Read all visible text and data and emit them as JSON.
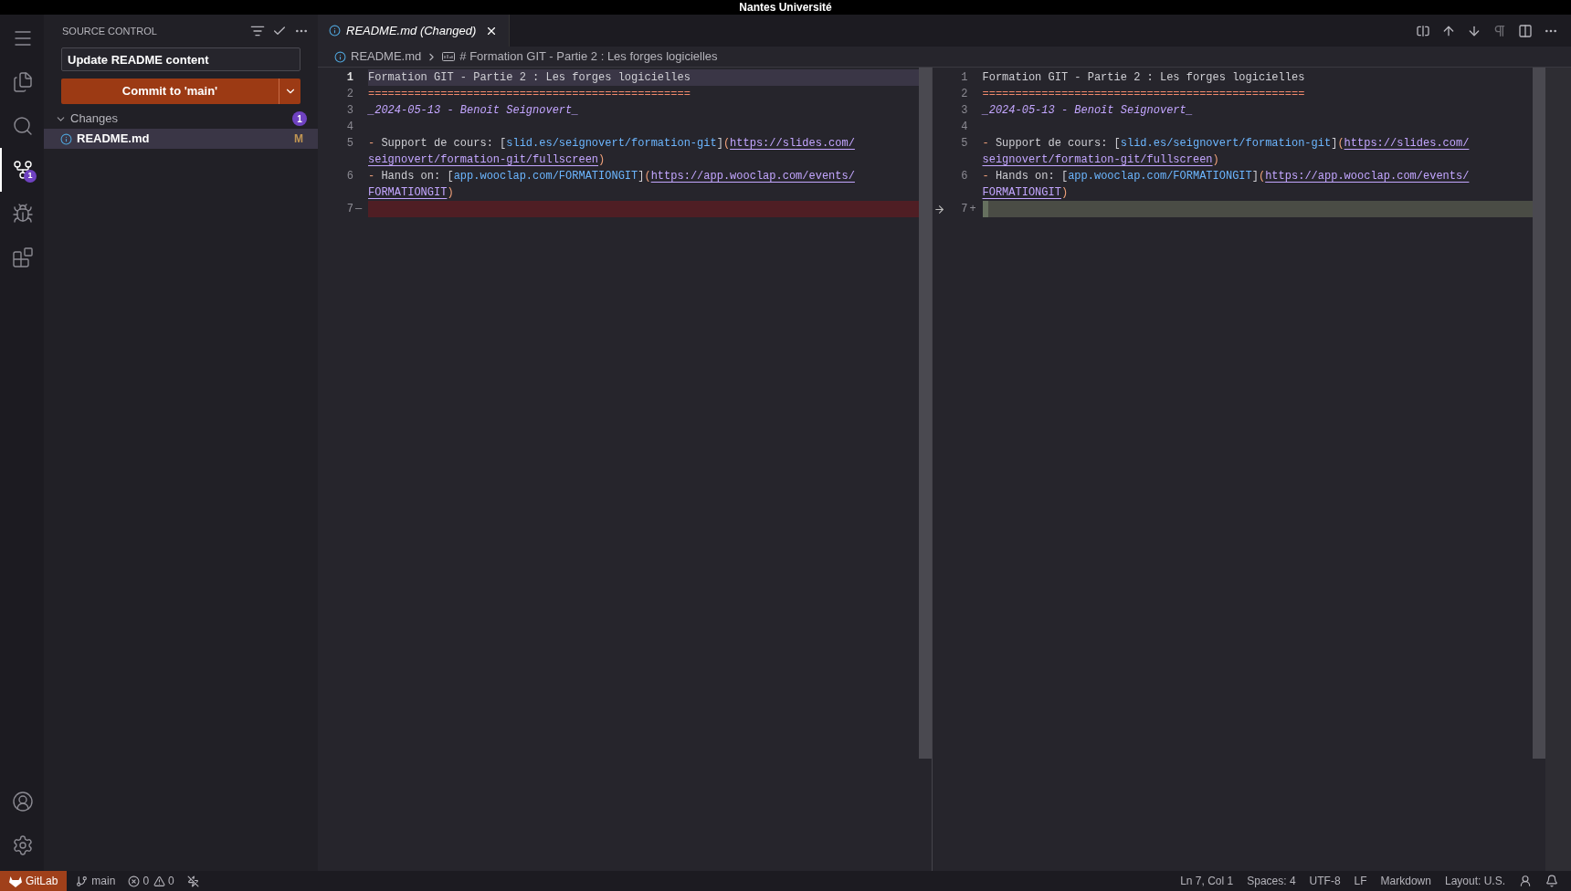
{
  "title_bar": {
    "title": "Nantes Université"
  },
  "activity_bar": {
    "items": [
      {
        "kind": "menu",
        "selected": false
      },
      {
        "kind": "explorer",
        "selected": false
      },
      {
        "kind": "search",
        "selected": false
      },
      {
        "kind": "source_control",
        "selected": true,
        "badge": "1"
      },
      {
        "kind": "debug",
        "selected": false
      },
      {
        "kind": "extensions",
        "selected": false
      }
    ],
    "bottom": [
      {
        "kind": "account",
        "selected": false
      },
      {
        "kind": "settings",
        "selected": false
      }
    ]
  },
  "sidebar": {
    "title": "SOURCE CONTROL",
    "message": {
      "value": "Update README content"
    },
    "commit_button": "Commit to 'main'",
    "changes": {
      "label": "Changes",
      "expanded": true,
      "count": "1",
      "files": [
        {
          "name": "README.md",
          "status": "M",
          "selected": true
        }
      ]
    }
  },
  "editor": {
    "tabs": [
      {
        "label": "README.md (Changed)",
        "selected": true
      }
    ],
    "breadcrumb": [
      "README.md",
      "# Formation GIT - Partie 2 : Les forges logicielles"
    ],
    "panes": [
      {
        "lines": [
          {
            "number": "1",
            "highlighted": true,
            "kind": "unchanged",
            "segments": [
              {
                "kind": "plain",
                "text": "Formation GIT - Partie 2 : Les forges logicielles"
              }
            ]
          },
          {
            "number": "2",
            "highlighted": false,
            "kind": "unchanged",
            "segments": [
              {
                "kind": "rule",
                "text": "================================================="
              }
            ]
          },
          {
            "number": "3",
            "highlighted": false,
            "kind": "unchanged",
            "segments": [
              {
                "kind": "emph",
                "text": "_2024-05-13 - Benoît Seignovert_"
              }
            ]
          },
          {
            "number": "4",
            "highlighted": false,
            "kind": "unchanged"
          },
          {
            "number": "5",
            "highlighted": false,
            "kind": "unchanged",
            "segments": [
              {
                "kind": "punct",
                "text": "- "
              },
              {
                "kind": "plain",
                "text": "Support de cours: ["
              },
              {
                "kind": "link",
                "text": "slid.es/seignovert/formation-git"
              },
              {
                "kind": "plain",
                "text": "]"
              },
              {
                "kind": "punct",
                "text": "("
              },
              {
                "kind": "url",
                "text": "https://slides.com/"
              }
            ],
            "wrapped_segments": [
              {
                "kind": "url",
                "text": "seignovert/formation-git/fullscreen"
              },
              {
                "kind": "punct",
                "text": ")"
              }
            ]
          },
          {
            "number": "6",
            "highlighted": false,
            "kind": "unchanged",
            "segments": [
              {
                "kind": "punct",
                "text": "- "
              },
              {
                "kind": "plain",
                "text": "Hands on: ["
              },
              {
                "kind": "link",
                "text": "app.wooclap.com/FORMATIONGIT"
              },
              {
                "kind": "plain",
                "text": "]"
              },
              {
                "kind": "punct",
                "text": "("
              },
              {
                "kind": "url",
                "text": "https://app.wooclap.com/events/"
              }
            ],
            "wrapped_segments": [
              {
                "kind": "url",
                "text": "FORMATIONGIT"
              },
              {
                "kind": "punct",
                "text": ")"
              }
            ]
          },
          {
            "number": "7",
            "highlighted": false,
            "kind": "removed",
            "marker": "—"
          }
        ]
      },
      {
        "lines": [
          {
            "number": "1",
            "highlighted": false,
            "kind": "unchanged",
            "segments": [
              {
                "kind": "plain",
                "text": "Formation GIT - Partie 2 : Les forges logicielles"
              }
            ]
          },
          {
            "number": "2",
            "highlighted": false,
            "kind": "unchanged",
            "segments": [
              {
                "kind": "rule",
                "text": "================================================="
              }
            ]
          },
          {
            "number": "3",
            "highlighted": false,
            "kind": "unchanged",
            "segments": [
              {
                "kind": "emph",
                "text": "_2024-05-13 - Benoît Seignovert_"
              }
            ]
          },
          {
            "number": "4",
            "highlighted": false,
            "kind": "unchanged"
          },
          {
            "number": "5",
            "highlighted": false,
            "kind": "unchanged",
            "segments": [
              {
                "kind": "punct",
                "text": "- "
              },
              {
                "kind": "plain",
                "text": "Support de cours: ["
              },
              {
                "kind": "link",
                "text": "slid.es/seignovert/formation-git"
              },
              {
                "kind": "plain",
                "text": "]"
              },
              {
                "kind": "punct",
                "text": "("
              },
              {
                "kind": "url",
                "text": "https://slides.com/"
              }
            ],
            "wrapped_segments": [
              {
                "kind": "url",
                "text": "seignovert/formation-git/fullscreen"
              },
              {
                "kind": "punct",
                "text": ")"
              }
            ]
          },
          {
            "number": "6",
            "highlighted": false,
            "kind": "unchanged",
            "segments": [
              {
                "kind": "punct",
                "text": "- "
              },
              {
                "kind": "plain",
                "text": "Hands on: ["
              },
              {
                "kind": "link",
                "text": "app.wooclap.com/FORMATIONGIT"
              },
              {
                "kind": "plain",
                "text": "]"
              },
              {
                "kind": "punct",
                "text": "("
              },
              {
                "kind": "url",
                "text": "https://app.wooclap.com/events/"
              }
            ],
            "wrapped_segments": [
              {
                "kind": "url",
                "text": "FORMATIONGIT"
              },
              {
                "kind": "punct",
                "text": ")"
              }
            ]
          },
          {
            "number": "7",
            "highlighted": false,
            "kind": "added",
            "marker": "+"
          }
        ]
      }
    ]
  },
  "status_bar": {
    "remote": "GitLab",
    "branch": "main",
    "errors": "0",
    "warnings": "0",
    "right": [
      "Ln 7, Col 1",
      "Spaces: 4",
      "UTF-8",
      "LF",
      "Markdown",
      "Layout: U.S."
    ]
  }
}
